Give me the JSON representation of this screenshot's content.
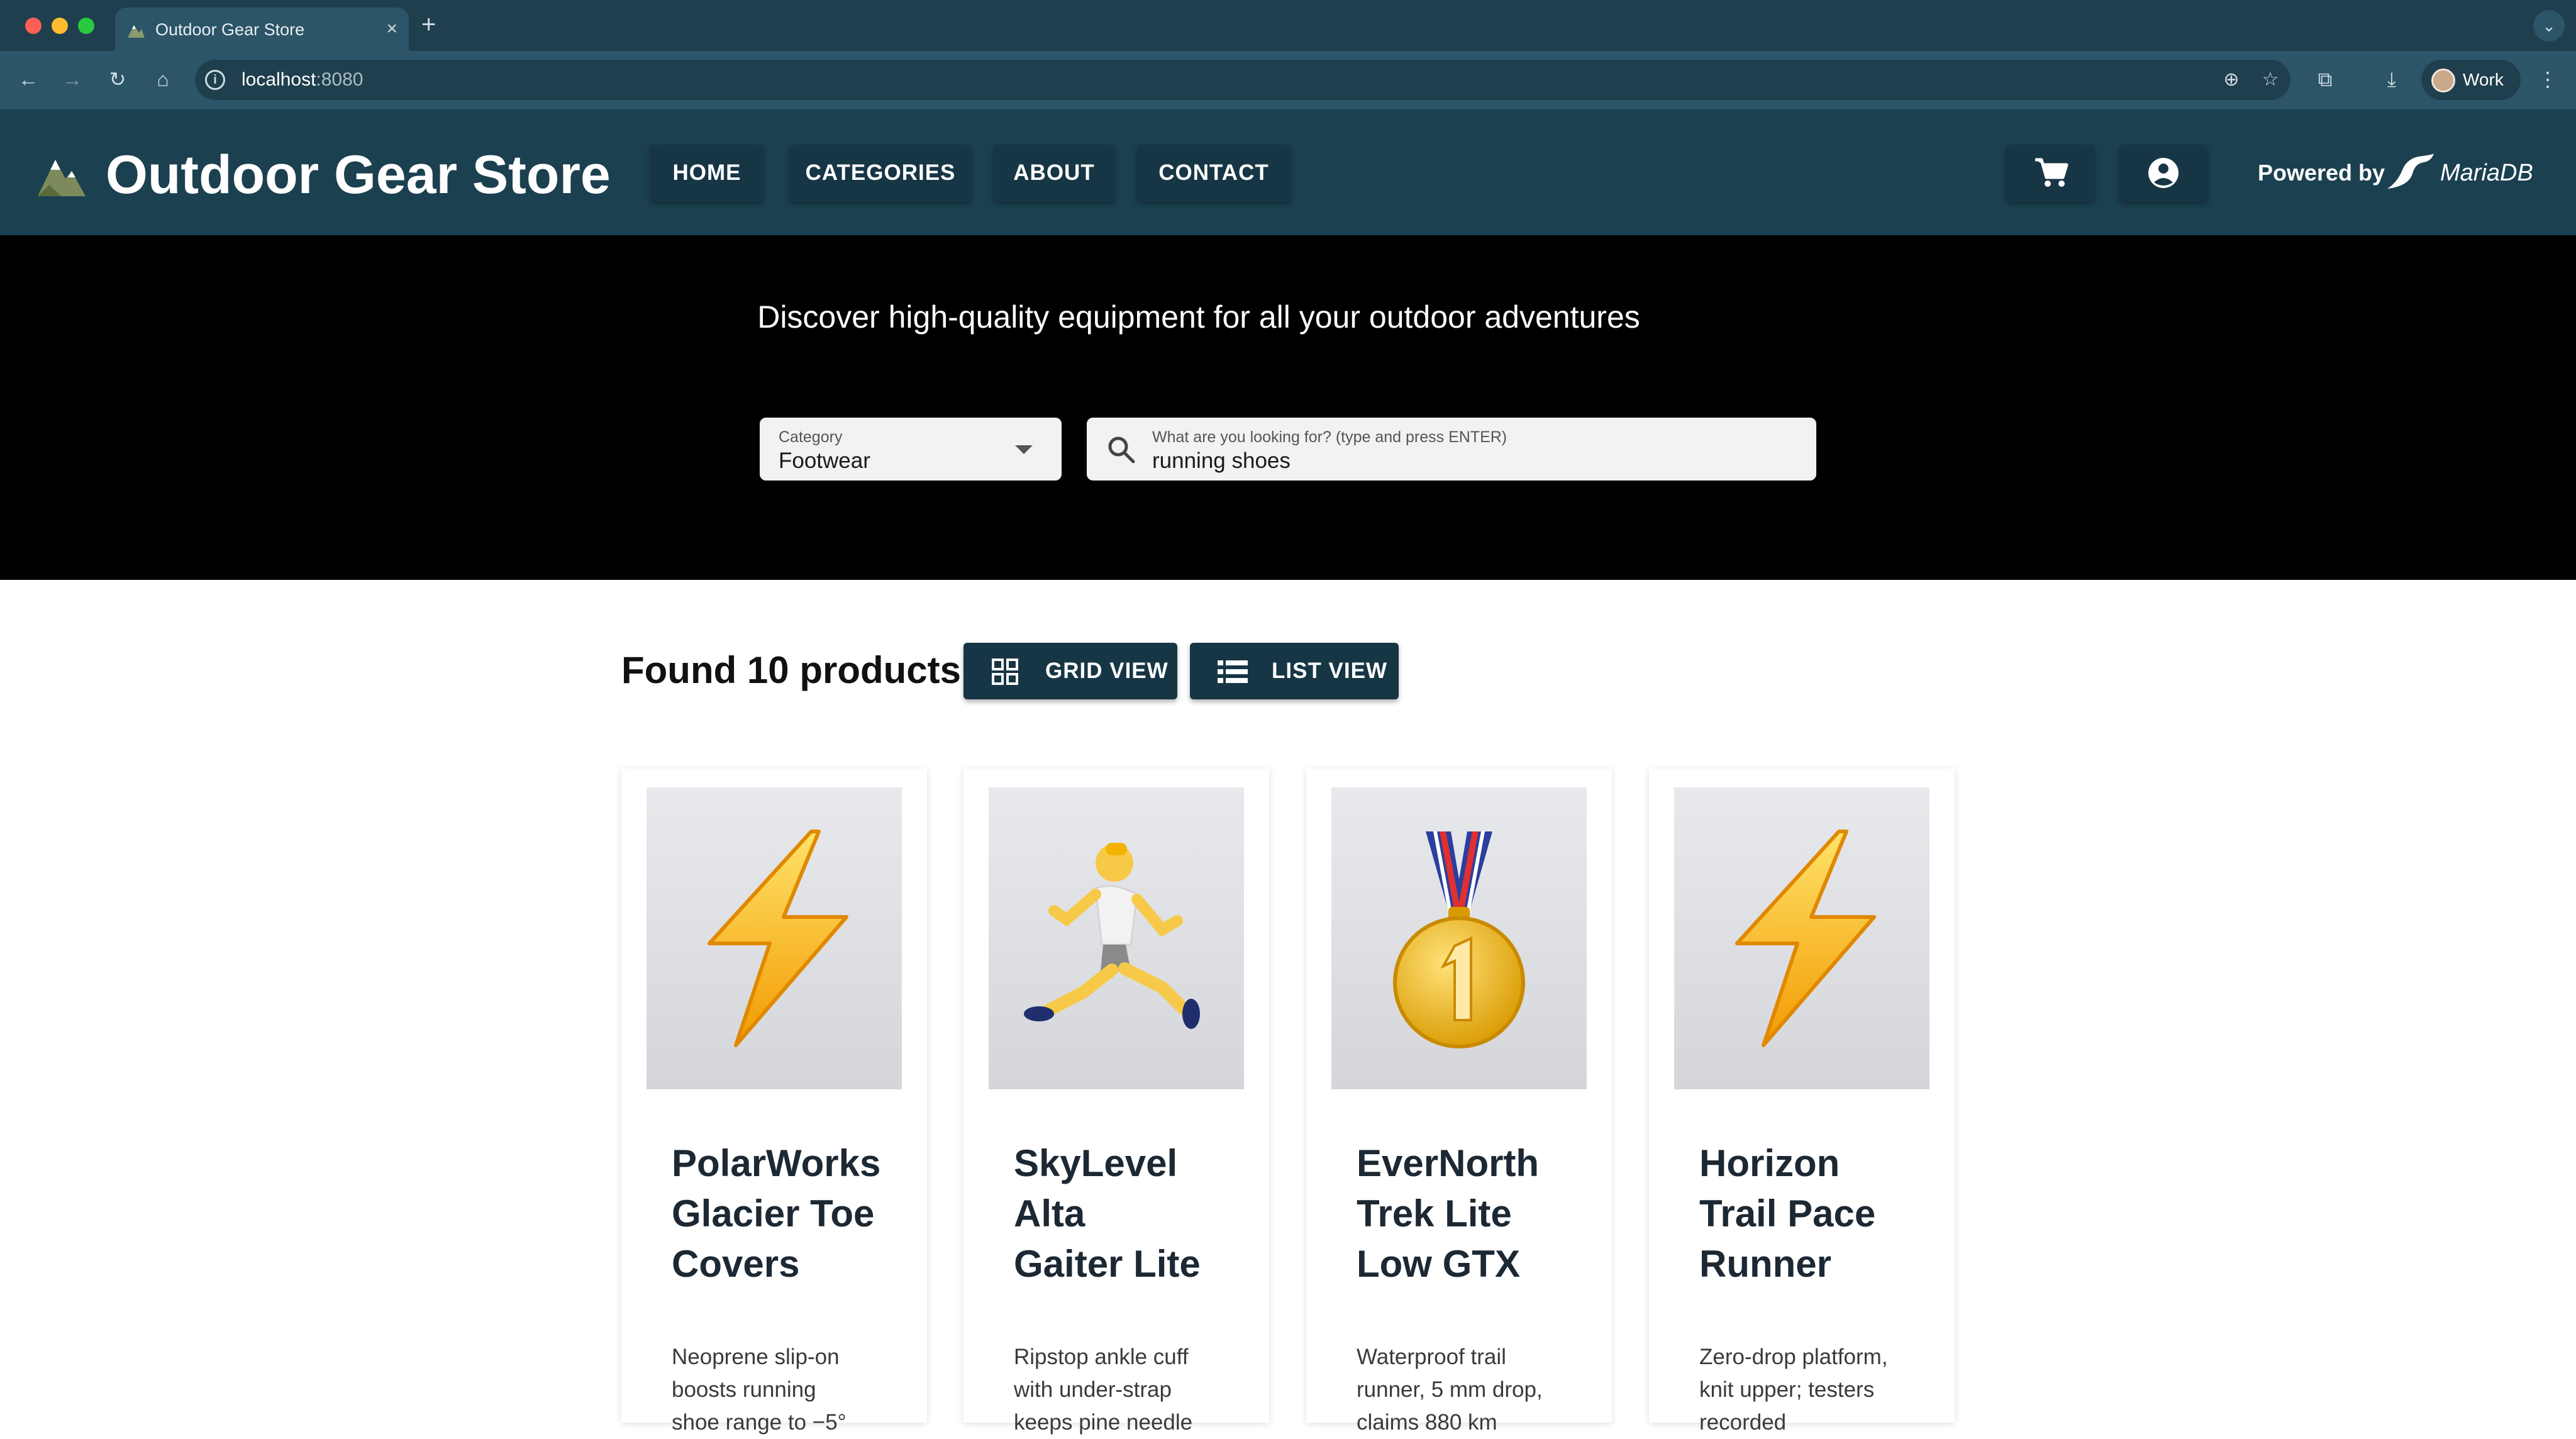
{
  "browser": {
    "tab_title": "Outdoor Gear Store",
    "tab_close": "×",
    "new_tab": "+",
    "tab_menu": "⌄",
    "url_host": "localhost",
    "url_port": ":8080",
    "profile_name": "Work"
  },
  "header": {
    "title": "Outdoor Gear Store",
    "nav": [
      "HOME",
      "CATEGORIES",
      "ABOUT",
      "CONTACT"
    ],
    "powered_by": "Powered by",
    "mariadb": "MariaDB"
  },
  "hero": {
    "tagline": "Discover high-quality equipment for all your outdoor adventures",
    "category_label": "Category",
    "category_value": "Footwear",
    "search_label": "What are you looking for? (type and press ENTER)",
    "search_value": "running shoes"
  },
  "results": {
    "title": "Found 10 products",
    "grid_view": "GRID VIEW",
    "list_view": "LIST VIEW"
  },
  "products": [
    {
      "name": "PolarWorks\nGlacier Toe\nCovers",
      "desc": "Neoprene slip-on\nboosts running\nshoe range to −5°",
      "image": "lightning-icon"
    },
    {
      "name": "SkyLevel\nAlta\nGaiter Lite",
      "desc": "Ripstop ankle cuff\nwith under-strap\nkeeps pine needle",
      "image": "runner-icon"
    },
    {
      "name": "EverNorth\nTrek Lite\nLow GTX",
      "desc": "Waterproof trail\nrunner, 5 mm drop,\nclaims 880 km",
      "image": "medal-icon"
    },
    {
      "name": "Horizon\nTrail Pace\nRunner",
      "desc": "Zero-drop platform,\nknit upper; testers\nrecorded",
      "image": "lightning-icon"
    }
  ],
  "colors": {
    "header_bg": "#1b4050",
    "button_bg": "#173645",
    "hero_bg": "#000000"
  }
}
